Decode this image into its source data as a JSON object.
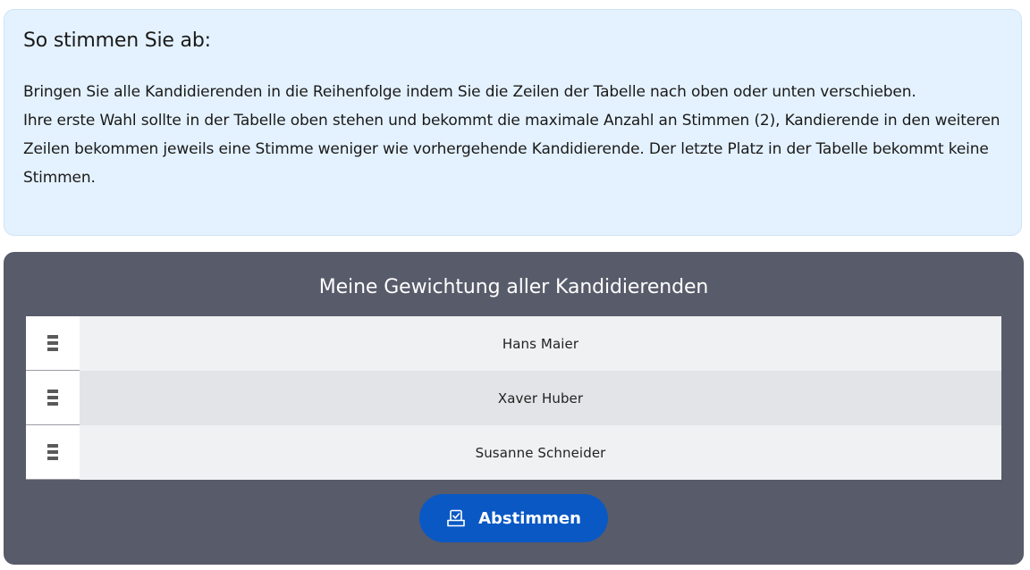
{
  "instructions": {
    "title": "So stimmen Sie ab:",
    "paragraph1": "Bringen Sie alle Kandidierenden in die Reihenfolge indem Sie die Zeilen der Tabelle nach oben oder unten verschieben.",
    "paragraph2": "Ihre erste Wahl sollte in der Tabelle oben stehen und bekommt die maximale Anzahl an Stimmen (2), Kandierende in den weiteren Zeilen bekommen jeweils eine Stimme weniger wie vorhergehende Kandidierende. Der letzte Platz in der Tabelle bekommt keine Stimmen."
  },
  "ranking": {
    "title": "Meine Gewichtung aller Kandidierenden",
    "candidates": [
      {
        "name": "Hans Maier"
      },
      {
        "name": "Xaver Huber"
      },
      {
        "name": "Susanne Schneider"
      }
    ],
    "handle_icon": "drag-handle-icon"
  },
  "submit": {
    "label": "Abstimmen",
    "icon": "ballot-box-icon"
  },
  "colors": {
    "info_background": "#e4f2ff",
    "panel_background": "#585b6a",
    "button_primary": "#0a58c4"
  }
}
